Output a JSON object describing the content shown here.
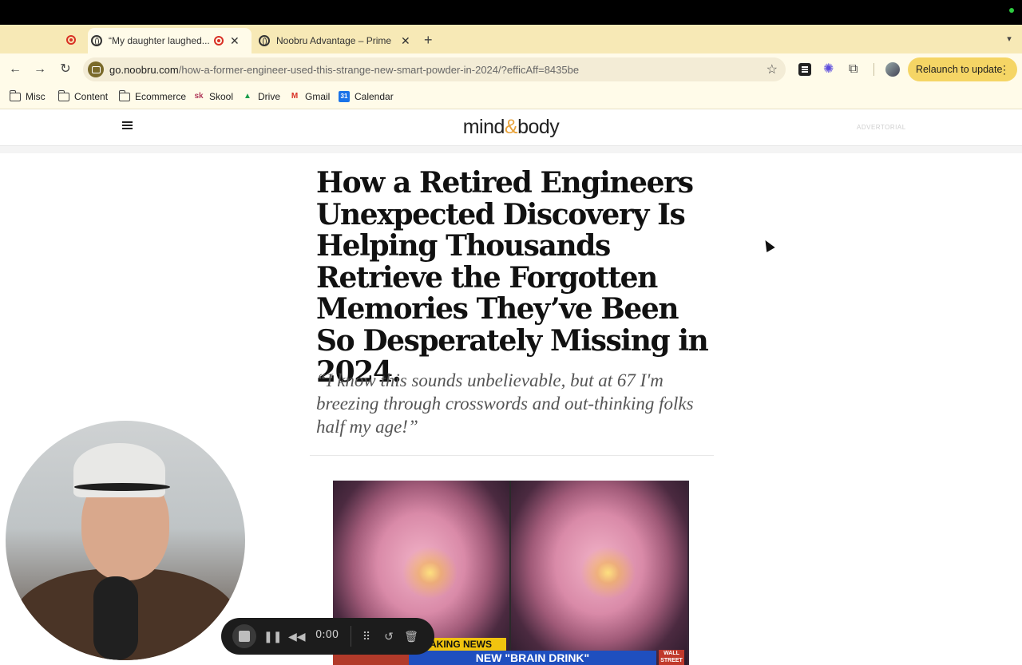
{
  "browser": {
    "tabs": [
      {
        "label": "“My daughter laughed...",
        "active": true
      },
      {
        "label": "Noobru Advantage – Prime M",
        "active": false
      }
    ],
    "url_host": "go.noobru.com",
    "url_path": "/how-a-former-engineer-used-this-strange-new-smart-powder-in-2024/?efficAff=8435be",
    "relaunch_label": "Relaunch to update",
    "bookmarks": [
      "Misc",
      "Content",
      "Ecommerce",
      "Skool",
      "Drive",
      "Gmail",
      "Calendar"
    ]
  },
  "site": {
    "logo_left": "mind",
    "logo_amp": "&",
    "logo_right": "body",
    "advertorial": "ADVERTORIAL"
  },
  "article": {
    "headline": "How a Retired Engineers Unexpected Discovery Is Helping Thousands Retrieve the Forgotten Memories They’ve Been So Desperately Missing in 2024.",
    "subhead": "“I know this sounds unbelievable, but at 67 I'm breezing through crosswords and out-thinking folks half my age!”",
    "image": {
      "breaking": "AKING NEWS",
      "ticker": "NEW \"BRAIN DRINK\"",
      "corner": "WALL STREET WEEK"
    }
  },
  "recorder": {
    "time": "0:00"
  },
  "colors": {
    "tabstrip": "#f7e9b6",
    "toolbar": "#fffbe9",
    "relaunch": "#f5d565",
    "logo_amp": "#e8a33c"
  }
}
